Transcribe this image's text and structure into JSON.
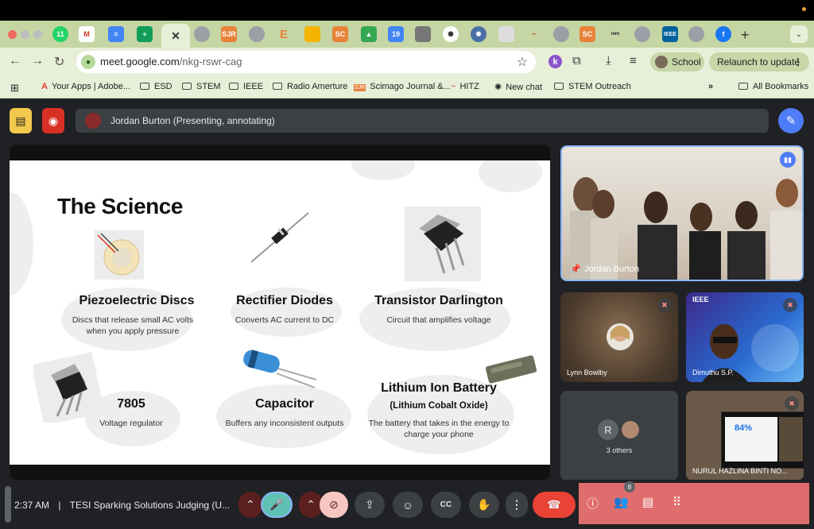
{
  "browser": {
    "url_host": "meet.google.com",
    "url_path": "/nkg-rswr-cag",
    "profile": "School",
    "relaunch": "Relaunch to update",
    "tabs": [
      "whatsapp",
      "gmail",
      "docs",
      "sheets",
      "active",
      "tab",
      "sjr",
      "tab",
      "etsy",
      "slides",
      "sc",
      "drive",
      "calendar",
      "tab",
      "openai",
      "gear",
      "image",
      "hitz",
      "tab",
      "sc",
      "mtab",
      "tab",
      "ieee",
      "tab",
      "facebook"
    ],
    "active_tab_icon": "✕",
    "bookmarks": [
      {
        "label": "Your Apps | Adobe...",
        "icon": "adobe-icon"
      },
      {
        "label": "ESD",
        "icon": "folder-icon"
      },
      {
        "label": "STEM",
        "icon": "folder-icon"
      },
      {
        "label": "IEEE",
        "icon": "folder-icon"
      },
      {
        "label": "Radio Amerture",
        "icon": "folder-icon"
      },
      {
        "label": "Scimago Journal &...",
        "icon": "sjr-icon"
      },
      {
        "label": "HITZ",
        "icon": "hitz-icon"
      },
      {
        "label": "New chat",
        "icon": "openai-icon"
      },
      {
        "label": "STEM Outreach",
        "icon": "folder-icon"
      }
    ],
    "all_bookmarks": "All Bookmarks"
  },
  "meet": {
    "presenter_banner": "Jordan Burton (Presenting, annotating)",
    "slide": {
      "title": "The Science",
      "items": [
        {
          "title": "Piezoelectric Discs",
          "desc": "Discs that release small AC volts when you apply pressure"
        },
        {
          "title": "Rectifier Diodes",
          "desc": "Converts AC current to DC"
        },
        {
          "title": "Transistor Darlington",
          "desc": "Circuit that amplifies voltage"
        },
        {
          "title": "7805",
          "desc": "Voltage regulator"
        },
        {
          "title": "Capacitor",
          "desc": "Buffers any inconsistent outputs"
        },
        {
          "title": "Lithium Ion Battery",
          "subtitle": "(Lithium Cobalt Oxide)",
          "desc": "The battery that takes in the energy to charge your phone"
        }
      ]
    },
    "participants": {
      "main": "Jordan Burton",
      "tile2": "Lynn Bowlby",
      "tile3": "Dimuthu S.P.",
      "others": "3 others",
      "others_initial": "R",
      "tile5": "NURUL HAZLINA BINTI NO...",
      "ieee_tag": "IEEE",
      "inner_percent": "84%"
    },
    "bottom": {
      "time": "2:37 AM",
      "separator": "|",
      "meeting_title": "TESI Sparking Solutions Judging (U...",
      "people_count": "8"
    }
  }
}
